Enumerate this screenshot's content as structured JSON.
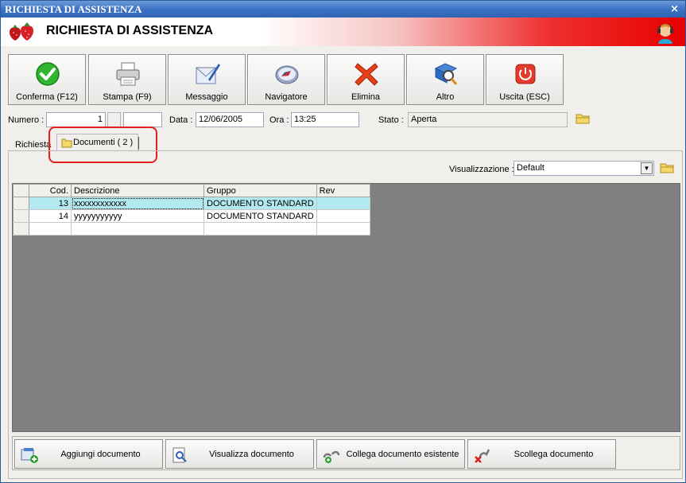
{
  "window": {
    "title": "RICHIESTA DI ASSISTENZA",
    "close_glyph": "×"
  },
  "header": {
    "title": "RICHIESTA DI ASSISTENZA",
    "logo_icon": "strawberry-logo",
    "support_icon": "support-agent-icon",
    "accent_color": "#e80000"
  },
  "toolbar": {
    "buttons": [
      {
        "label": "Conferma (F12)",
        "icon": "checkmark-icon"
      },
      {
        "label": "Stampa (F9)",
        "icon": "printer-icon"
      },
      {
        "label": "Messaggio",
        "icon": "message-icon"
      },
      {
        "label": "Navigatore",
        "icon": "compass-icon"
      },
      {
        "label": "Elimina",
        "icon": "delete-x-icon"
      },
      {
        "label": "Altro",
        "icon": "book-search-icon"
      },
      {
        "label": "Uscita (ESC)",
        "icon": "power-icon"
      }
    ]
  },
  "form": {
    "numero_label": "Numero :",
    "numero_value": "1",
    "data_label": "Data :",
    "data_value": "12/06/2005",
    "ora_label": "Ora :",
    "ora_value": "13:25",
    "stato_label": "Stato :",
    "stato_value": "Aperta"
  },
  "tabs": [
    {
      "label": "Richiesta"
    },
    {
      "label": "Documenti ( 2 )",
      "active": true
    }
  ],
  "view": {
    "label": "Visualizzazione :",
    "selected": "Default"
  },
  "grid": {
    "columns": [
      "Cod.",
      "Descrizione",
      "Gruppo",
      "Rev"
    ],
    "rows": [
      {
        "cod": "13",
        "descrizione": "xxxxxxxxxxxx",
        "gruppo": "DOCUMENTO STANDARD",
        "rev": ""
      },
      {
        "cod": "14",
        "descrizione": "yyyyyyyyyyy",
        "gruppo": "DOCUMENTO STANDARD",
        "rev": ""
      }
    ],
    "highlight_color": "#b2eaf0",
    "background_color": "#808080"
  },
  "bottom": {
    "buttons": [
      {
        "label": "Aggiungi documento",
        "icon": "add-document-icon"
      },
      {
        "label": "Visualizza documento",
        "icon": "view-document-icon"
      },
      {
        "label": "Collega documento esistente",
        "icon": "link-document-icon"
      },
      {
        "label": "Scollega documento",
        "icon": "unlink-document-icon"
      }
    ]
  }
}
